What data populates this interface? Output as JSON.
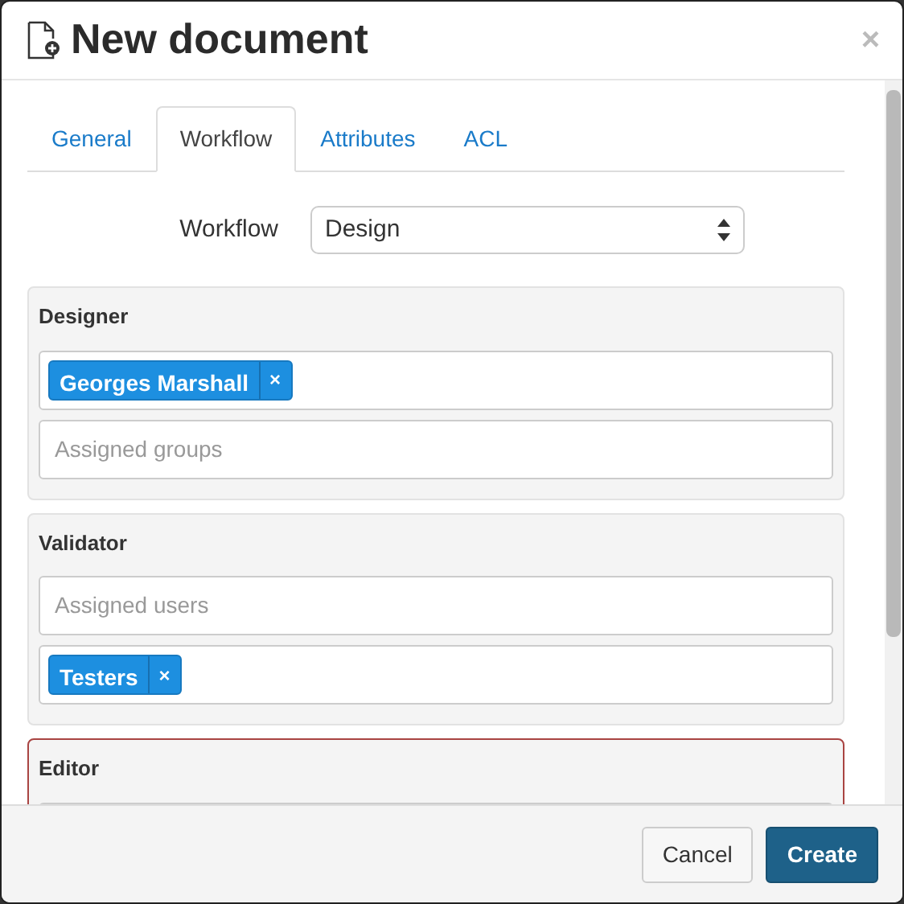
{
  "window": {
    "title": "New document",
    "close": "×"
  },
  "tabs": [
    {
      "label": "General",
      "selected": false
    },
    {
      "label": "Workflow",
      "selected": true
    },
    {
      "label": "Attributes",
      "selected": false
    },
    {
      "label": "ACL",
      "selected": false
    }
  ],
  "workflow": {
    "label": "Workflow",
    "value": "Design"
  },
  "panels": [
    {
      "title": "Designer",
      "invalid": false,
      "fields": [
        {
          "kind": "tags",
          "tags": [
            {
              "label": "Georges Marshall",
              "remove": "×"
            }
          ]
        },
        {
          "kind": "text",
          "placeholder": "Assigned groups"
        }
      ]
    },
    {
      "title": "Validator",
      "invalid": false,
      "fields": [
        {
          "kind": "text",
          "placeholder": "Assigned users"
        },
        {
          "kind": "tags",
          "tags": [
            {
              "label": "Testers",
              "remove": "×"
            }
          ]
        }
      ]
    },
    {
      "title": "Editor",
      "invalid": true,
      "fields": [
        {
          "kind": "text"
        }
      ]
    }
  ],
  "buttons": [
    {
      "label": "Cancel",
      "kind": "secondary"
    },
    {
      "label": "Create",
      "kind": "primary"
    }
  ]
}
